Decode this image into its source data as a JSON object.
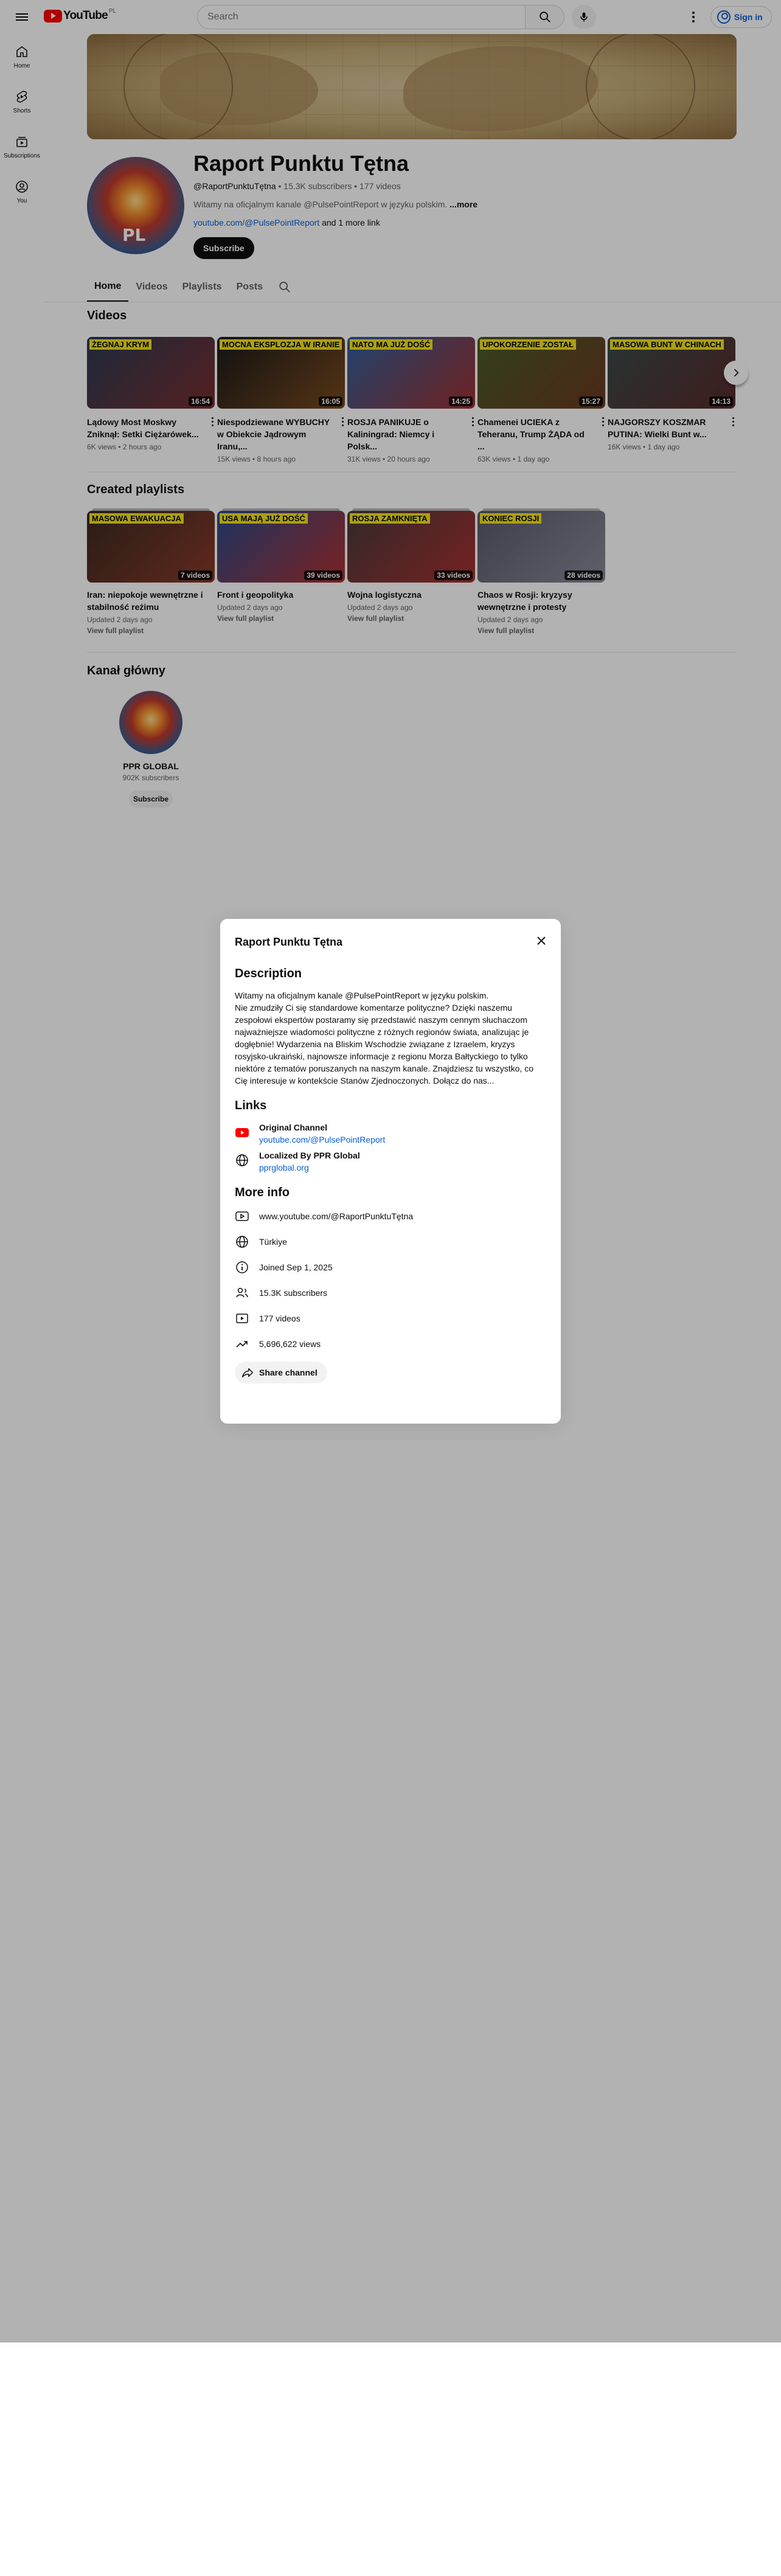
{
  "header": {
    "logo_text": "YouTube",
    "logo_country": "PL",
    "search_placeholder": "Search",
    "signin_label": "Sign in"
  },
  "sidenav": {
    "items": [
      {
        "label": "Home",
        "icon": "home-icon"
      },
      {
        "label": "Shorts",
        "icon": "shorts-icon"
      },
      {
        "label": "Subscriptions",
        "icon": "subscriptions-icon"
      },
      {
        "label": "You",
        "icon": "you-icon"
      }
    ]
  },
  "channel": {
    "title": "Raport Punktu Tętna",
    "handle": "@RaportPunktuTętna",
    "meta": " • 15.3K subscribers • 177 videos",
    "desc_prefix": "Witamy na oficjalnym kanale @PulsePointReport w języku polskim.",
    "desc_more": "...more",
    "link_text": "youtube.com/@PulsePointReport",
    "link_more": " and 1 more link",
    "subscribe_label": "Subscribe"
  },
  "tabs": [
    "Home",
    "Videos",
    "Playlists",
    "Posts"
  ],
  "sections": {
    "videos_title": "Videos",
    "playlists_title": "Created playlists",
    "main_channel_title": "Kanał główny"
  },
  "videos": [
    {
      "tag": "ŻEGNAJ KRYM",
      "duration": "16:54",
      "title": "Lądowy Most Moskwy Zniknął: Setki Ciężarówek...",
      "meta": "6K views • 2 hours ago",
      "c1": "#2b3a55",
      "c2": "#7a2e2e"
    },
    {
      "tag": "MOCNA EKSPLOZJA W IRANIE",
      "duration": "16:05",
      "title": "Niespodziewane WYBUCHY w Obiekcie Jądrowym Iranu,...",
      "meta": "15K views • 8 hours ago",
      "c1": "#1a1a1a",
      "c2": "#7a4a1e"
    },
    {
      "tag": "NATO MA JUŻ DOŚĆ",
      "duration": "14:25",
      "title": "ROSJA PANIKUJE o Kaliningrad: Niemcy i Polsk...",
      "meta": "31K views • 20 hours ago",
      "c1": "#2f5f9c",
      "c2": "#a03030"
    },
    {
      "tag": "UPOKORZENIE ZOSTAŁ",
      "duration": "15:27",
      "title": "Chamenei UCIEKA z Teheranu, Trump ŻĄDA od ...",
      "meta": "63K views • 1 day ago",
      "c1": "#4a5a2a",
      "c2": "#6b3a20"
    },
    {
      "tag": "MASOWA BUNT W CHINACH",
      "duration": "14:13",
      "title": "NAJGORSZY KOSZMAR PUTINA: Wielki Bunt w...",
      "meta": "16K views • 1 day ago",
      "c1": "#3a4a4a",
      "c2": "#5a2a2a"
    }
  ],
  "playlists": [
    {
      "tag": "MASOWA EWAKUACJA",
      "count": "7 videos",
      "title": "Iran: niepokoje wewnętrzne i stabilność reżimu",
      "meta": "Updated 2 days ago",
      "link": "View full playlist",
      "c1": "#3a2a20",
      "c2": "#8a3a2a"
    },
    {
      "tag": "USA MAJĄ JUŻ DOŚĆ",
      "count": "39 videos",
      "title": "Front i geopolityka",
      "meta": "Updated 2 days ago",
      "link": "View full playlist",
      "c1": "#2a4a8a",
      "c2": "#b03030"
    },
    {
      "tag": "ROSJA ZAMKNIĘTA",
      "count": "33 videos",
      "title": "Wojna logistyczna",
      "meta": "Updated 2 days ago",
      "link": "View full playlist",
      "c1": "#4a3a3a",
      "c2": "#aa3030"
    },
    {
      "tag": "KONIEC ROSJI",
      "count": "28 videos",
      "title": "Chaos w Rosji: kryzysy wewnętrzne i protesty",
      "meta": "Updated 2 days ago",
      "link": "View full playlist",
      "c1": "#5a5a6a",
      "c2": "#8a8a9a"
    }
  ],
  "main_channel": {
    "name": "PPR GLOBAL",
    "subs": "902K subscribers",
    "subscribe_label": "Subscribe"
  },
  "dialog": {
    "title": "Raport Punktu Tętna",
    "description_heading": "Description",
    "description_lines": [
      "Witamy na oficjalnym kanale @PulsePointReport w języku polskim.",
      "Nie zmudziły Ci się standardowe komentarze polityczne? Dzięki naszemu zespołowi ekspertów postaramy się przedstawić naszym cennym słuchaczom najważniejsze wiadomości polityczne z różnych regionów świata, analizując je dogłębnie! Wydarzenia na Bliskim Wschodzie związane z Izraelem, kryzys rosyjsko-ukraiński, najnowsze informacje z regionu Morza Bałtyckiego to tylko niektóre z tematów poruszanych na naszym kanale. Znajdziesz tu wszystko, co Cię interesuje w kontekście Stanów Zjednoczonych. Dołącz do nas..."
    ],
    "links_heading": "Links",
    "links": [
      {
        "name": "Original Channel",
        "url": "youtube.com/@PulsePointReport",
        "icon": "youtube-icon"
      },
      {
        "name": "Localized By PPR Global",
        "url": "pprglobal.org",
        "icon": "globe-icon"
      }
    ],
    "more_info_heading": "More info",
    "info": [
      {
        "icon": "channel-url-icon",
        "text": "www.youtube.com/@RaportPunktuTętna"
      },
      {
        "icon": "location-icon",
        "text": "Türkiye"
      },
      {
        "icon": "info-icon",
        "text": "Joined Sep 1, 2025"
      },
      {
        "icon": "subscribers-icon",
        "text": "15.3K subscribers"
      },
      {
        "icon": "videos-icon",
        "text": "177 videos"
      },
      {
        "icon": "views-icon",
        "text": "5,696,622 views"
      }
    ],
    "share_label": "Share channel"
  }
}
